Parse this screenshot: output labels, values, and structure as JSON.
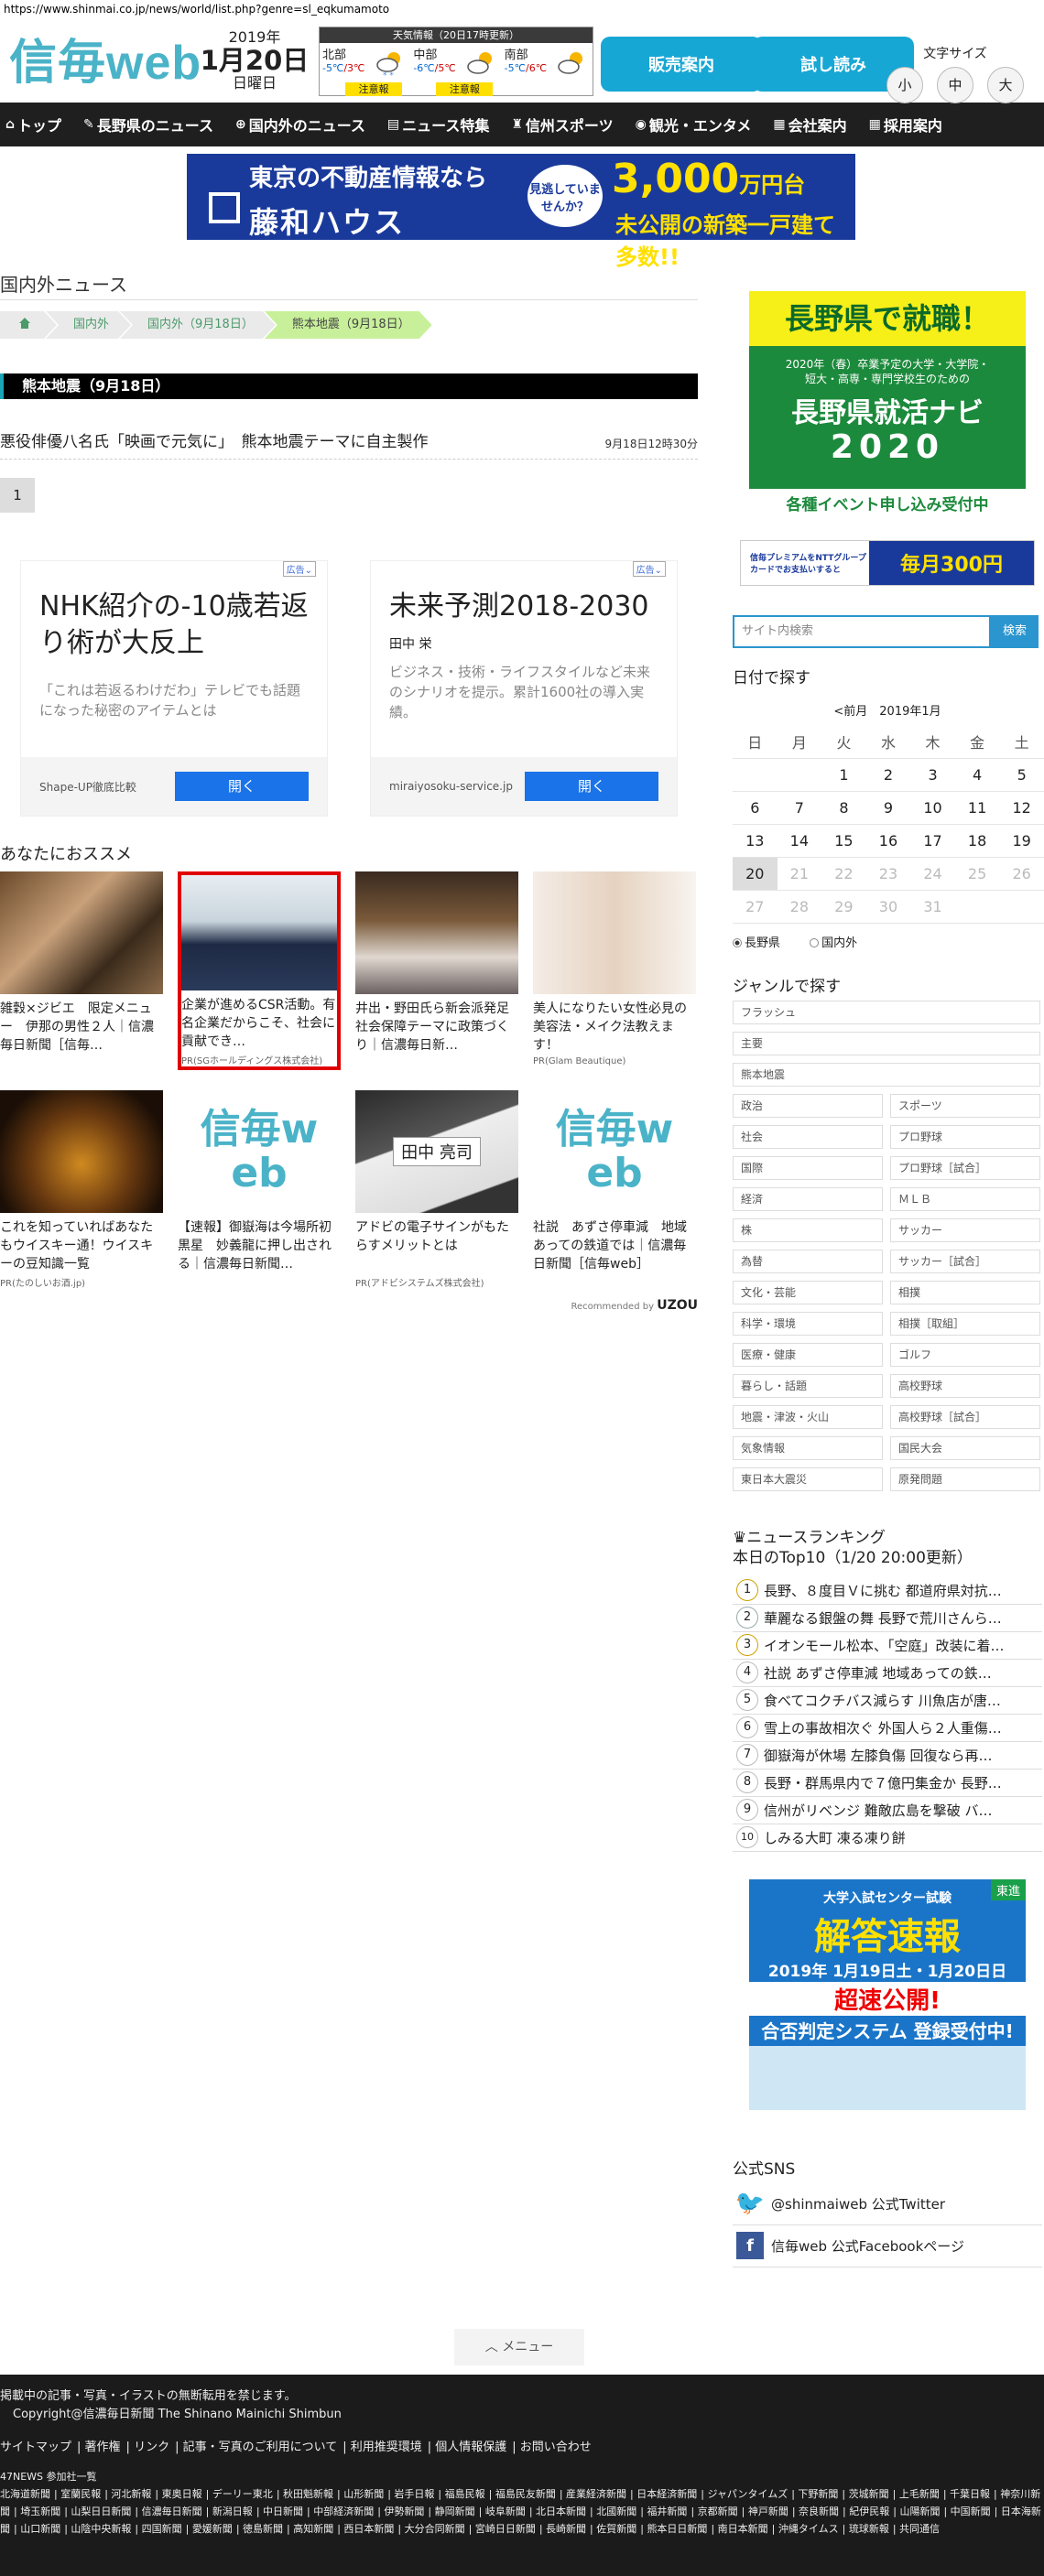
{
  "browser": {
    "url": "https://www.shinmai.co.jp/news/world/list.php?genre=sl_eqkumamoto"
  },
  "header": {
    "logo": "信毎web",
    "year": "2019年",
    "month_day": "1月20日",
    "weekday": "日曜日",
    "weather_title": "天気情報（20日17時更新）",
    "regions": [
      {
        "name": "北部",
        "low": "-5℃",
        "high": "3℃",
        "warning": "注意報"
      },
      {
        "name": "中部",
        "low": "-6℃",
        "high": "5℃",
        "warning": "注意報"
      },
      {
        "name": "南部",
        "low": "-5℃",
        "high": "6℃",
        "warning": ""
      }
    ],
    "btn_sales": "販売案内",
    "btn_trial": "試し読み",
    "fontsize_label": "文字サイズ",
    "fontsize_small": "小",
    "fontsize_mid": "中",
    "fontsize_large": "大"
  },
  "nav": {
    "items": [
      "トップ",
      "長野県のニュース",
      "国内外のニュース",
      "ニュース特集",
      "信州スポーツ",
      "観光・エンタメ",
      "会社案内",
      "採用案内"
    ]
  },
  "top_ad": {
    "line1": "東京の不動産情報なら",
    "line2": "藤和ハウス",
    "bubble": "見逃していませんか？",
    "price": "3,000",
    "price_unit": "万円台",
    "sub": "未公開の新築一戸建て多数!!"
  },
  "main": {
    "section_title": "国内外ニュース",
    "breadcrumb": [
      "国内外",
      "国内外（9月18日）",
      "熊本地震（9月18日）"
    ],
    "genre_title": "熊本地震（9月18日）",
    "article_title": "悪役俳優八名氏「映画で元気に」　熊本地震テーマに自主製作",
    "article_date": "9月18日12時30分",
    "page": "1"
  },
  "ads": [
    {
      "tag": "広告",
      "headline": "NHK紹介の-10歳若返り術が大反上",
      "sub": "",
      "text": "「これは若返るわけだわ」テレビでも話題になった秘密のアイテムとは",
      "source": "Shape-UP徹底比較",
      "button": "開く"
    },
    {
      "tag": "広告",
      "headline": "未来予測2018-2030",
      "sub": "田中 栄",
      "text": "ビジネス・技術・ライフスタイルなど未来のシナリオを提示。累計1600社の導入実績。",
      "source": "miraiyosoku-service.jp",
      "button": "開く"
    }
  ],
  "recommend": {
    "title": "あなたにおススメ",
    "items": [
      {
        "caption": "雑穀×ジビエ　限定メニュー　伊那の男性２人｜信濃毎日新聞［信毎…",
        "pr": ""
      },
      {
        "caption": "企業が進めるCSR活動。有名企業だからこそ、社会に貢献でき…",
        "pr": "PR(SGホールディングス株式会社)"
      },
      {
        "caption": "井出・野田氏ら新会派発足　社会保障テーマに政策づくり｜信濃毎日新…",
        "pr": ""
      },
      {
        "caption": "美人になりたい女性必見の美容法・メイク法教えます！",
        "pr": "PR(Glam Beautique)"
      },
      {
        "caption": "これを知っていればあなたもウイスキー通！ウイスキーの豆知識一覧",
        "pr": "PR(たのしいお酒.jp)"
      },
      {
        "caption": "【速報】御嶽海は今場所初黒星　妙義龍に押し出される｜信濃毎日新聞…",
        "pr": ""
      },
      {
        "caption": "アドビの電子サインがもたらすメリットとは",
        "pr": "PR(アドビシステムズ株式会社)"
      },
      {
        "caption": "社説　あずさ停車減　地域あっての鉄道では｜信濃毎日新聞［信毎web］",
        "pr": ""
      }
    ],
    "logo_text": "信毎web",
    "stamp_text": "田中 亮司",
    "recommended_by": "Recommended by",
    "uzou": "UZOU"
  },
  "side": {
    "ad1": {
      "top": "長野県で就職！",
      "mid1": "2020年（春）卒業予定の大学・大学院・",
      "mid2": "短大・高専・専門学校生のための",
      "name": "長野県就活ナビ",
      "year": "2020",
      "bottom": "各種イベント申し込み受付中"
    },
    "ad2": {
      "left": "信毎プレミアムをNTTグループカードでお支払いすると",
      "right": "毎月300円"
    },
    "search_placeholder": "サイト内検索",
    "search_button": "検索",
    "calendar_title": "日付で探す",
    "calendar_prev": "<前月",
    "calendar_month": "2019年1月",
    "weekdays": [
      "日",
      "月",
      "火",
      "水",
      "木",
      "金",
      "土"
    ],
    "weeks": [
      [
        "",
        "",
        "1",
        "2",
        "3",
        "4",
        "5"
      ],
      [
        "6",
        "7",
        "8",
        "9",
        "10",
        "11",
        "12"
      ],
      [
        "13",
        "14",
        "15",
        "16",
        "17",
        "18",
        "19"
      ],
      [
        "20",
        "21",
        "22",
        "23",
        "24",
        "25",
        "26"
      ],
      [
        "27",
        "28",
        "29",
        "30",
        "31",
        "",
        ""
      ]
    ],
    "today": "20",
    "radio_local": "長野県",
    "radio_world": "国内外",
    "genre_title": "ジャンルで探す",
    "genres_wide": [
      "フラッシュ",
      "主要",
      "熊本地震"
    ],
    "genres": [
      "政治",
      "スポーツ",
      "社会",
      "プロ野球",
      "国際",
      "プロ野球［試合］",
      "経済",
      "ＭＬＢ",
      "株",
      "サッカー",
      "為替",
      "サッカー［試合］",
      "文化・芸能",
      "相撲",
      "科学・環境",
      "相撲［取組］",
      "医療・健康",
      "ゴルフ",
      "暮らし・話題",
      "高校野球",
      "地震・津波・火山",
      "高校野球［試合］",
      "気象情報",
      "国民大会",
      "東日本大震災",
      "原発問題"
    ],
    "ranking_title": "ニュースランキング",
    "ranking_sub": "本日のTop10（1/20 20:00更新）",
    "ranking": [
      "長野、８度目Ｖに挑む 都道府県対抗…",
      "華麗なる銀盤の舞 長野で荒川さんら…",
      "イオンモール松本、「空庭」改装に着…",
      "社説 あずさ停車減 地域あっての鉄…",
      "食べてコクチバス減らす 川魚店が唐…",
      "雪上の事故相次ぐ 外国人ら２人重傷…",
      "御嶽海が休場 左膝負傷 回復なら再…",
      "長野・群馬県内で７億円集金か 長野…",
      "信州がリベンジ 難敵広島を撃破 バ…",
      "しみる大町 凍る凍り餅"
    ],
    "ad3": {
      "a": "大学入試センター試験",
      "b": "解答速報",
      "c": "2019年 1月19日土・1月20日日",
      "d": "超速公開!",
      "e": "合否判定システム 登録受付中!",
      "badge": "東進"
    },
    "sns_title": "公式SNS",
    "sns_twitter": "@shinmaiweb 公式Twitter",
    "sns_facebook": "信毎web 公式Facebookページ"
  },
  "menu_button": "メニュー",
  "footer": {
    "notice": "掲載中の記事・写真・イラストの無断転用を禁じます。",
    "copyright": "Copyright@信濃毎日新聞 The Shinano Mainichi Shimbun",
    "links": [
      "サイトマップ",
      "著作権",
      "リンク",
      "記事・写真のご利用について",
      "利用推奨環境",
      "個人情報保護",
      "お問い合わせ"
    ],
    "n47_label": "47NEWS 参加社一覧",
    "papers": [
      "北海道新聞",
      "室蘭民報",
      "河北新報",
      "東奥日報",
      "デーリー東北",
      "秋田魁新報",
      "山形新聞",
      "岩手日報",
      "福島民報",
      "福島民友新聞",
      "産業経済新聞",
      "日本経済新聞",
      "ジャパンタイムズ",
      "下野新聞",
      "茨城新聞",
      "上毛新聞",
      "千葉日報",
      "神奈川新聞",
      "埼玉新聞",
      "山梨日日新聞",
      "信濃毎日新聞",
      "新潟日報",
      "中日新聞",
      "中部経済新聞",
      "伊勢新聞",
      "静岡新聞",
      "岐阜新聞",
      "北日本新聞",
      "北國新聞",
      "福井新聞",
      "京都新聞",
      "神戸新聞",
      "奈良新聞",
      "紀伊民報",
      "山陽新聞",
      "中国新聞",
      "日本海新聞",
      "山口新聞",
      "山陰中央新報",
      "四国新聞",
      "愛媛新聞",
      "徳島新聞",
      "高知新聞",
      "西日本新聞",
      "大分合同新聞",
      "宮崎日日新聞",
      "長崎新聞",
      "佐賀新聞",
      "熊本日日新聞",
      "南日本新聞",
      "沖縄タイムス",
      "琉球新報",
      "共同通信"
    ]
  },
  "colors": {
    "brand": "#4ab3c8",
    "button": "#17a7d4",
    "nav": "#1f1f1f",
    "highlight": "#e00000"
  }
}
